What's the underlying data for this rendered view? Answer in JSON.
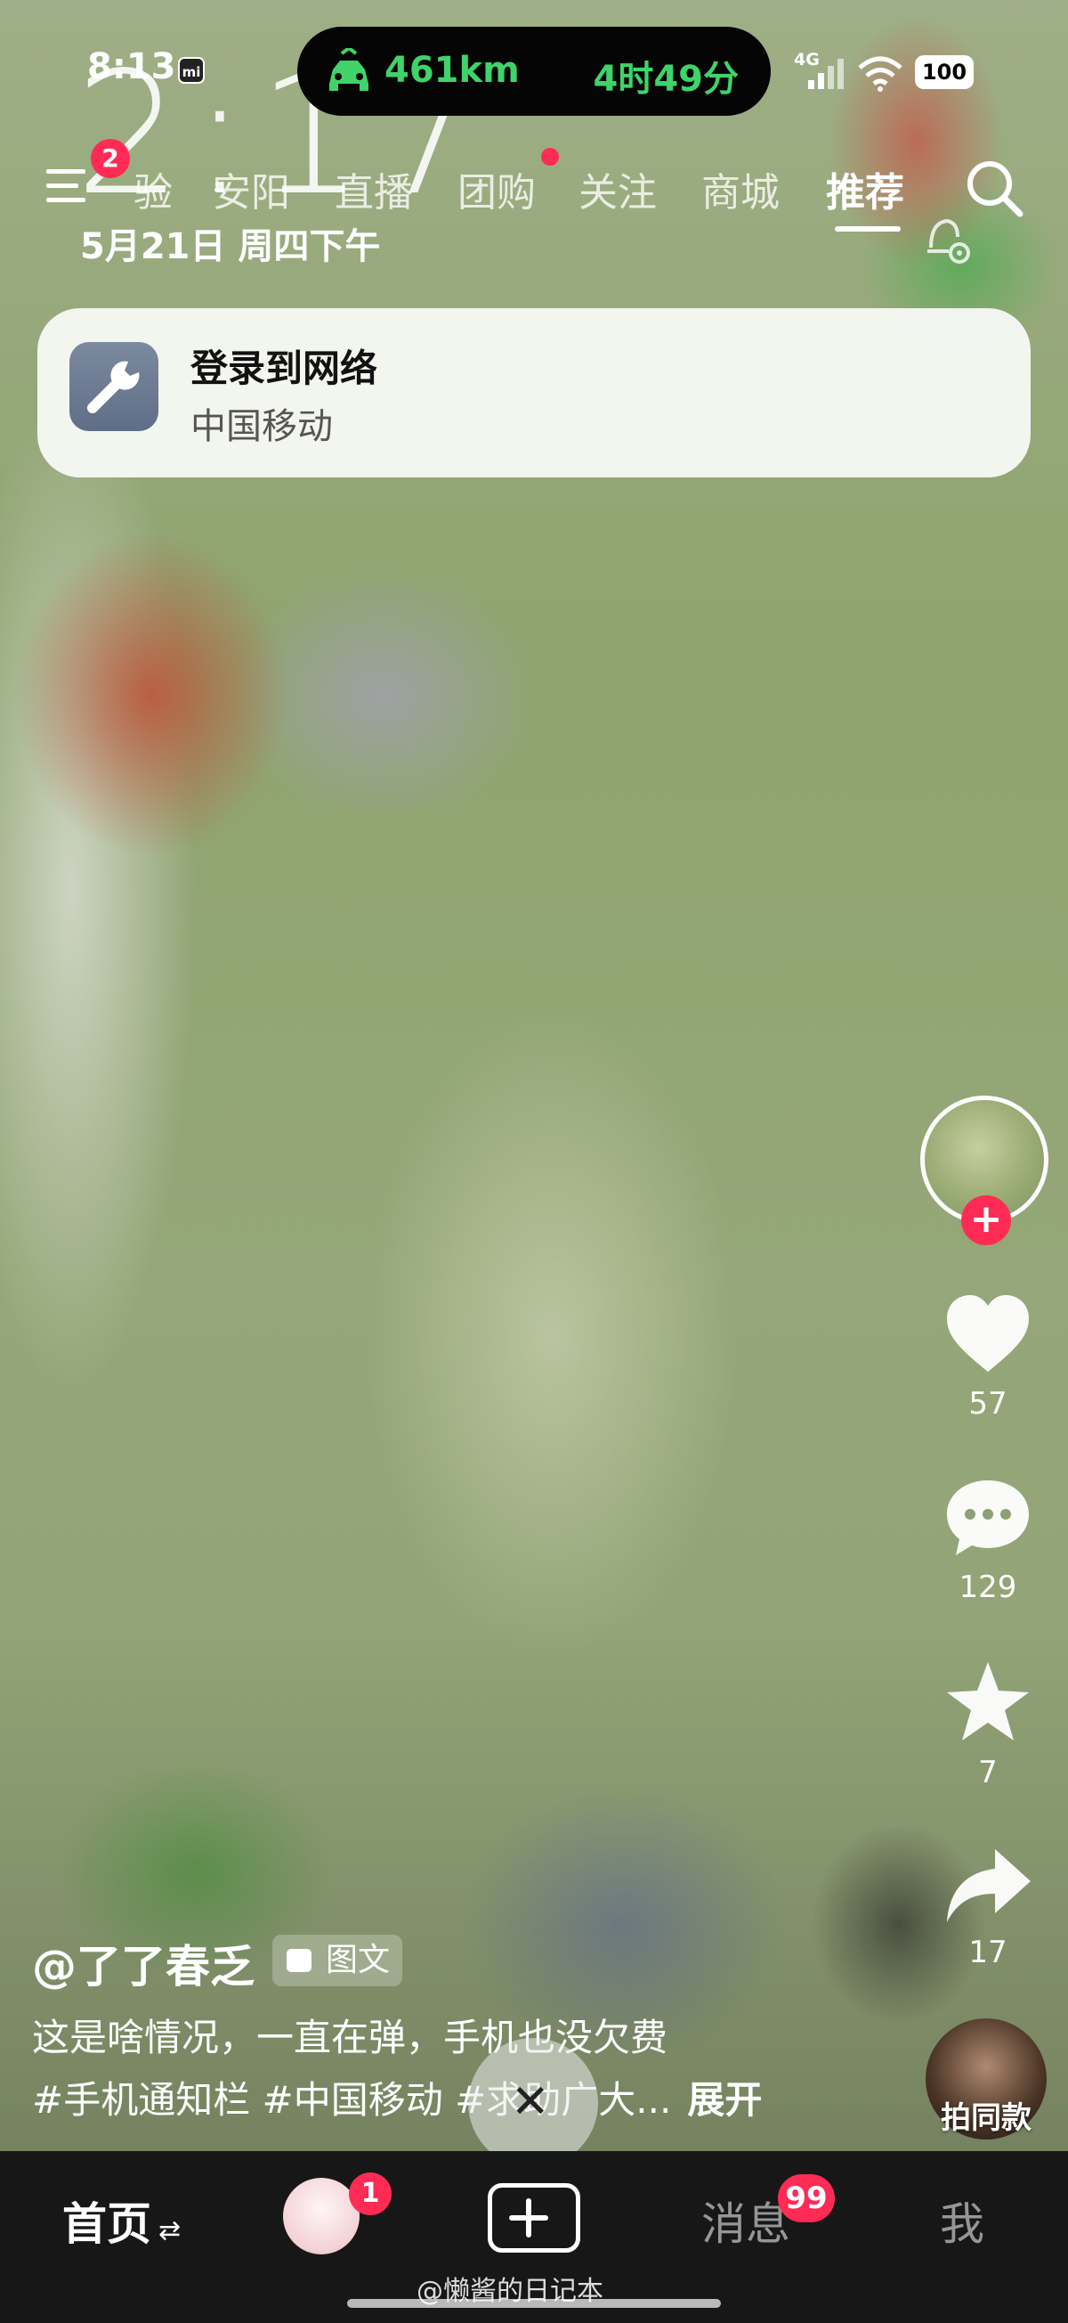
{
  "status_bar": {
    "time": "8:13",
    "mi_badge": "mi",
    "island_distance": "461km",
    "island_eta": "4时49分",
    "network": "4G",
    "battery": "100"
  },
  "lock_overlay": {
    "clock": "2:17",
    "date": "5月21日 周四下午"
  },
  "top_nav": {
    "menu_badge": "2",
    "tabs": [
      {
        "label": "验"
      },
      {
        "label": "安阳"
      },
      {
        "label": "直播"
      },
      {
        "label": "团购"
      },
      {
        "label": "关注"
      },
      {
        "label": "商城"
      },
      {
        "label": "推荐"
      }
    ],
    "active_tab": "推荐"
  },
  "notification": {
    "title": "登录到网络",
    "subtitle": "中国移动"
  },
  "right_rail": {
    "like_count": "57",
    "comment_count": "129",
    "favorite_count": "7",
    "share_count": "17",
    "same_style_label": "拍同款"
  },
  "post": {
    "author": "@了了春乏",
    "type_chip": "图文",
    "caption": "这是啥情况，一直在弹，手机也没欠费",
    "hashtags": "#手机通知栏 #中国移动 #求助广大...",
    "expand_label": "展开",
    "close_glyph": "✕"
  },
  "bottom_nav": {
    "home": "首页",
    "home_swap": "⇄",
    "friends_badge": "1",
    "messages": "消息",
    "messages_badge": "99",
    "me": "我",
    "watermark": "@懒酱的日记本"
  },
  "colors": {
    "accent_red": "#ff2b55",
    "island_green": "#3fd36a",
    "nav_background": "#171717"
  }
}
